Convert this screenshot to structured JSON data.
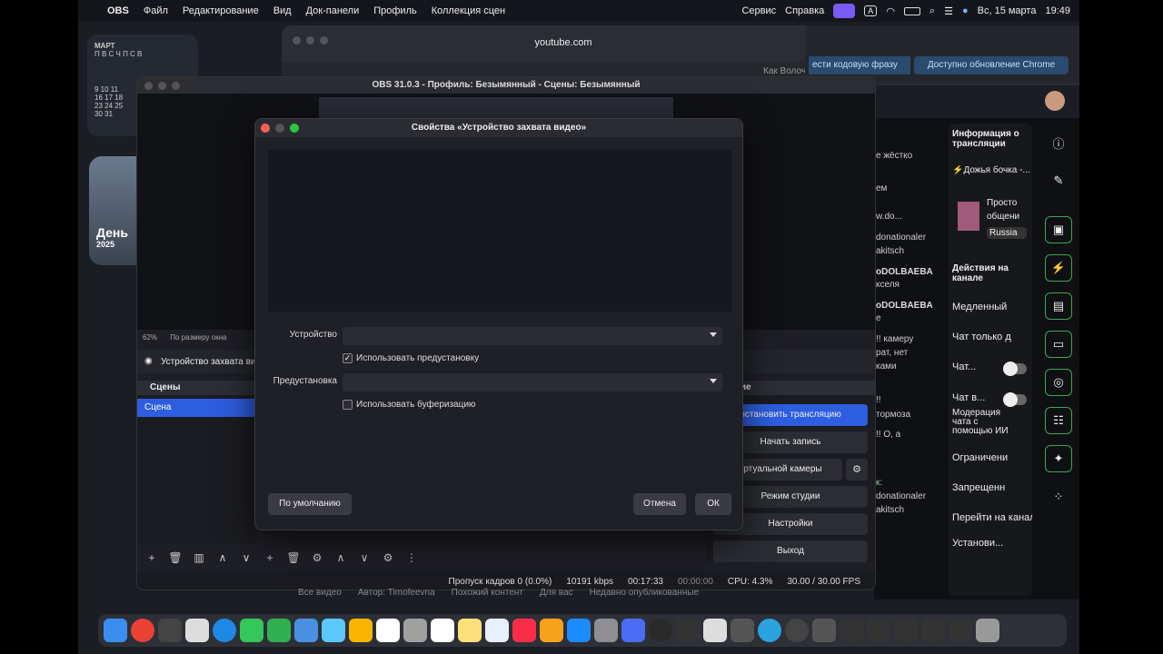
{
  "menubar": {
    "app": "OBS",
    "items": [
      "Файл",
      "Редактирование",
      "Вид",
      "Док-панели",
      "Профиль",
      "Коллекция сцен"
    ],
    "right_items": [
      "Сервис",
      "Справка"
    ],
    "date": "Вс, 15 марта",
    "time": "19:49"
  },
  "calendar": {
    "month": "МАРТ",
    "days_header": "П В С Ч П С В",
    "rows": [
      "9 10 11",
      "16 17 18",
      "23 24 25",
      "30 31"
    ]
  },
  "widget": {
    "title": "День",
    "year": "2025"
  },
  "safari": {
    "url": "youtube.com",
    "tab_text": "Как Волочкова скат..."
  },
  "chrome": {
    "code_text": "ести кодовую фразу",
    "update_text": "Доступно обновление Chrome"
  },
  "obs": {
    "title": "OBS 31.0.3 - Профиль: Безымянный - Сцены: Безымянный",
    "zoom": "62%",
    "fit": "По размеру окна",
    "source_label": "Устройство захвата вид",
    "scenes_header": "Сцены",
    "scene_item": "Сцена",
    "controls_header": "пление",
    "controls": [
      "остановить трансляцию",
      "Начать запись",
      "виртуальной камеры",
      "Режим студии",
      "Настройки",
      "Выход"
    ],
    "status": {
      "dropped": "Пропуск кадров 0 (0.0%)",
      "bitrate": "10191 kbps",
      "stream_time": "00:17:33",
      "rec_time": "00:00:00",
      "cpu": "CPU: 4.3%",
      "fps": "30.00 / 30.00 FPS"
    }
  },
  "dialog": {
    "title": "Свойства «Устройство захвата видео»",
    "device_label": "Устройство",
    "device_value": "",
    "use_preset_label": "Использовать предустановку",
    "use_preset_checked": true,
    "preset_label": "Предустановка",
    "preset_value": "",
    "buffering_label": "Использовать буферизацию",
    "buffering_checked": false,
    "defaults_button": "По умолчанию",
    "cancel_button": "Отмена",
    "ok_button": "ОК"
  },
  "youtube": {
    "info_title": "Информация о трансляции",
    "stream_title": "⚡Дожья бочка -...",
    "category_a": "Просто",
    "category_b": "общени",
    "language": "Russia",
    "actions_title": "Действия на канале",
    "actions": [
      "Медленный",
      "Чат только д",
      "Чат...",
      "Чат в...",
      "Модерация чата с помощью ИИ",
      "Ограничени",
      "Запрещенн",
      "Перейти на канал",
      "Установи..."
    ],
    "chat": [
      "е жёстко",
      "ем",
      "w.do...",
      "donationaler",
      "akitsch",
      "oDOLBAEBA",
      "кселя",
      "oDOLBAEBA",
      "е",
      "!! камеру",
      "рат, нет",
      "ками",
      "!!",
      "тормоза",
      "!! О, а",
      "к:",
      "donationaler",
      "akitsch"
    ]
  },
  "ytbar": [
    "Все видео",
    "Автор: Timofeevna",
    "Похожий контент",
    "Для вас",
    "Недавно опубликованные"
  ]
}
